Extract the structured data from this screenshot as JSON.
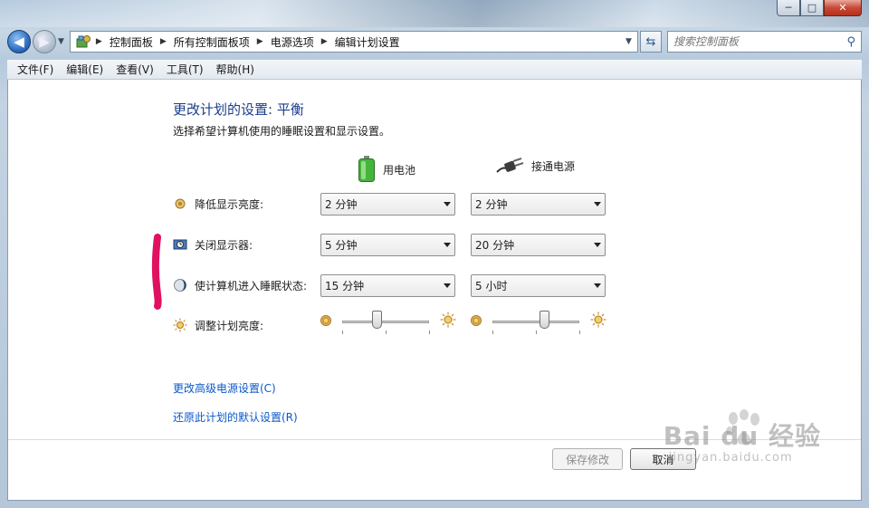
{
  "window": {
    "minimize_label": "─",
    "maximize_label": "□",
    "close_label": "✕"
  },
  "address_bar": {
    "crumbs": [
      "控制面板",
      "所有控制面板项",
      "电源选项",
      "编辑计划设置"
    ],
    "search_placeholder": "搜索控制面板"
  },
  "menu": [
    "文件(F)",
    "编辑(E)",
    "查看(V)",
    "工具(T)",
    "帮助(H)"
  ],
  "page": {
    "title": "更改计划的设置: 平衡",
    "subtitle": "选择希望计算机使用的睡眠设置和显示设置。"
  },
  "columns": {
    "battery": "用电池",
    "plugged": "接通电源"
  },
  "settings": [
    {
      "label": "降低显示亮度:",
      "battery": "2 分钟",
      "plugged": "2 分钟",
      "icon": "dim-brightness-icon"
    },
    {
      "label": "关闭显示器:",
      "battery": "5 分钟",
      "plugged": "20 分钟",
      "icon": "monitor-off-icon"
    },
    {
      "label": "使计算机进入睡眠状态:",
      "battery": "15 分钟",
      "plugged": "5 小时",
      "icon": "sleep-icon"
    }
  ],
  "brightness": {
    "label": "调整计划亮度:",
    "battery_level": 0.4,
    "plugged_level": 0.6
  },
  "links": {
    "advanced": "更改高级电源设置(C)",
    "restore": "还原此计划的默认设置(R)"
  },
  "buttons": {
    "save": "保存修改",
    "cancel": "取消"
  },
  "watermark": {
    "main": "Bai du 经验",
    "url": "jingyan.baidu.com"
  },
  "colors": {
    "title": "#1a3d8a",
    "link": "#0b59c8",
    "marker": "#e0115f"
  }
}
